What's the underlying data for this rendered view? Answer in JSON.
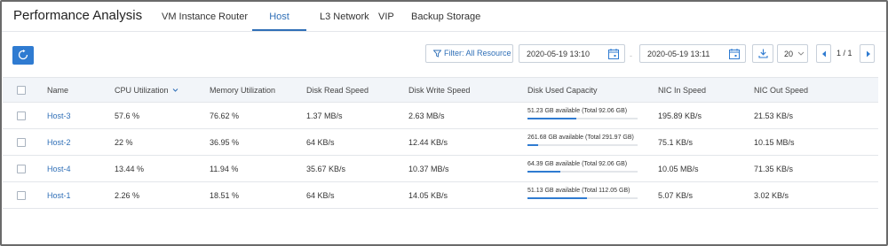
{
  "header": {
    "title": "Performance Analysis",
    "tabs": [
      {
        "label": "VM Instance"
      },
      {
        "label": "Router"
      },
      {
        "label": "Host",
        "active": true
      },
      {
        "label": "L3 Network"
      },
      {
        "label": "VIP"
      },
      {
        "label": "Backup Storage"
      }
    ]
  },
  "toolbar": {
    "refresh_icon": "refresh-icon",
    "filter_label": "Filter: All Resource",
    "filter_icon": "filter-icon",
    "start_date": "2020-05-19 13:10",
    "end_date": "2020-05-19 13:11",
    "date_separator": "-",
    "calendar_icon": "calendar-icon",
    "export_icon": "download-icon",
    "page_size": "20",
    "pager": "1 / 1"
  },
  "table": {
    "columns": [
      "Name",
      "CPU Utilization",
      "Memory Utilization",
      "Disk Read Speed",
      "Disk Write Speed",
      "Disk Used Capacity",
      "NIC In Speed",
      "NIC Out Speed"
    ],
    "sort_icon": "chevron-down-icon",
    "rows": [
      {
        "name": "Host-3",
        "cpu": "57.6 %",
        "mem": "76.62 %",
        "read": "1.37 MB/s",
        "write": "2.63 MB/s",
        "cap_text": "51.23 GB available  (Total 92.06 GB)",
        "cap_used": 0.44,
        "nic_in": "195.89 KB/s",
        "nic_out": "21.53 KB/s"
      },
      {
        "name": "Host-2",
        "cpu": "22 %",
        "mem": "36.95 %",
        "read": "64 KB/s",
        "write": "12.44 KB/s",
        "cap_text": "261.68 GB available  (Total 291.97 GB)",
        "cap_used": 0.1,
        "nic_in": "75.1 KB/s",
        "nic_out": "10.15 MB/s"
      },
      {
        "name": "Host-4",
        "cpu": "13.44 %",
        "mem": "11.94 %",
        "read": "35.67 KB/s",
        "write": "10.37 MB/s",
        "cap_text": "64.39 GB available  (Total 92.06 GB)",
        "cap_used": 0.3,
        "nic_in": "10.05 MB/s",
        "nic_out": "71.35 KB/s"
      },
      {
        "name": "Host-1",
        "cpu": "2.26 %",
        "mem": "18.51 %",
        "read": "64 KB/s",
        "write": "14.05 KB/s",
        "cap_text": "51.13 GB available  (Total 112.05 GB)",
        "cap_used": 0.54,
        "nic_in": "5.07 KB/s",
        "nic_out": "3.02 KB/s"
      }
    ]
  },
  "colors": {
    "accent": "#2f7bd1",
    "link": "#2f6fb7",
    "header_bg": "#f2f5f9",
    "border": "#e3e6ea"
  }
}
